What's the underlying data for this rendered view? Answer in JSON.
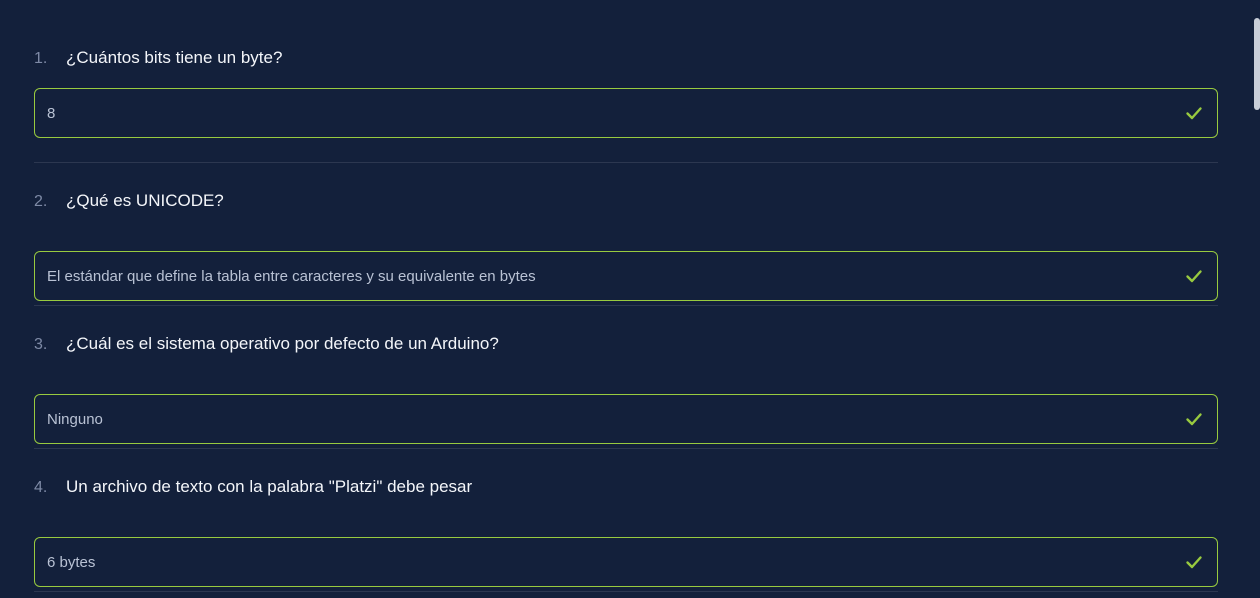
{
  "questions": [
    {
      "number": "1.",
      "text": "¿Cuántos bits tiene un byte?",
      "answer": "8",
      "status_icon": "check-icon"
    },
    {
      "number": "2.",
      "text": "¿Qué es UNICODE?",
      "answer": "El estándar que define la tabla entre caracteres y su equivalente en bytes",
      "status_icon": "check-icon"
    },
    {
      "number": "3.",
      "text": "¿Cuál es el sistema operativo por defecto de un Arduino?",
      "answer": "Ninguno",
      "status_icon": "check-icon"
    },
    {
      "number": "4.",
      "text": "Un archivo de texto con la palabra \"Platzi\" debe pesar",
      "answer": "6 bytes",
      "status_icon": "check-icon"
    }
  ],
  "colors": {
    "background": "#13203b",
    "correct_border": "#98ca3f",
    "check": "#98ca3f",
    "divider": "#2c3750"
  }
}
